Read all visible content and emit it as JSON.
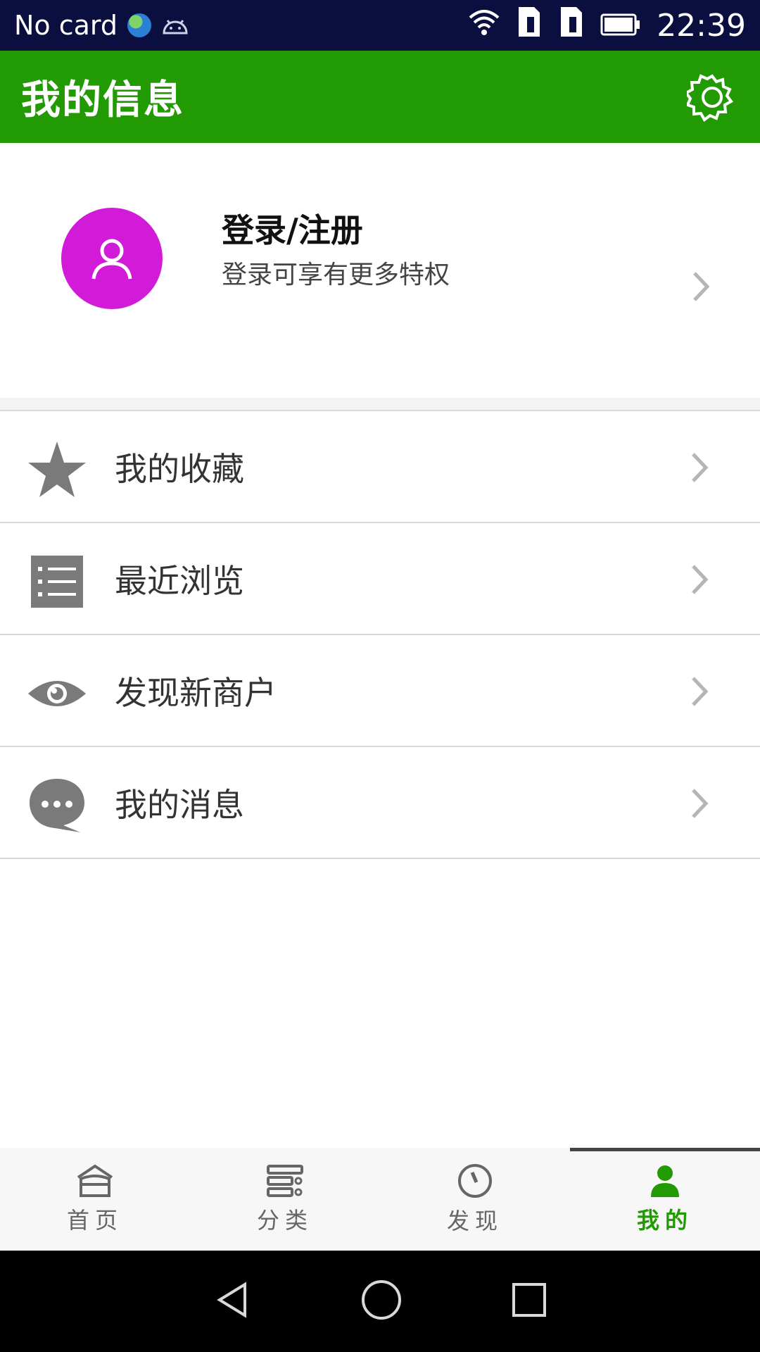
{
  "status_bar": {
    "carrier": "No card",
    "time": "22:39"
  },
  "header": {
    "title": "我的信息"
  },
  "profile": {
    "title": "登录/注册",
    "subtitle": "登录可享有更多特权"
  },
  "menu": [
    {
      "label": "我的收藏",
      "icon": "star-icon"
    },
    {
      "label": "最近浏览",
      "icon": "list-icon"
    },
    {
      "label": "发现新商户",
      "icon": "eye-icon"
    },
    {
      "label": "我的消息",
      "icon": "chat-icon"
    }
  ],
  "tabs": [
    {
      "label": "首页",
      "icon": "home-icon"
    },
    {
      "label": "分类",
      "icon": "category-icon"
    },
    {
      "label": "发现",
      "icon": "compass-icon"
    },
    {
      "label": "我的",
      "icon": "user-icon",
      "active": true
    }
  ],
  "colors": {
    "status_bar": "#0b0f3f",
    "header": "#229a04",
    "avatar": "#d11bd8",
    "active_tab": "#229a04",
    "icon_gray": "#7a7a7a"
  }
}
